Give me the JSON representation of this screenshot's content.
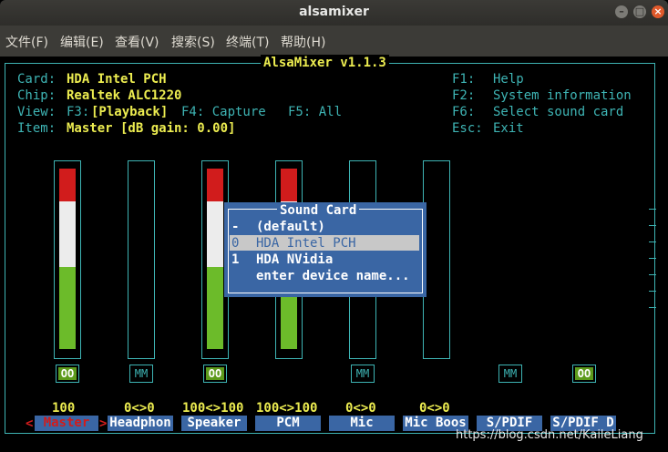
{
  "window": {
    "title": "alsamixer"
  },
  "menu": [
    "文件(F)",
    "编辑(E)",
    "查看(V)",
    "搜索(S)",
    "终端(T)",
    "帮助(H)"
  ],
  "app": {
    "title": "AlsaMixer v1.1.3"
  },
  "info": {
    "card_label": "Card:",
    "card_value": "HDA Intel PCH",
    "chip_label": "Chip:",
    "chip_value": "Realtek ALC1220",
    "view_label": "View:",
    "view_f3": "F3:",
    "view_playback": "[Playback]",
    "view_f4": "F4: Capture",
    "view_f5": "F5: All",
    "item_label": "Item:",
    "item_value": "Master [dB gain: 0.00]"
  },
  "help": [
    {
      "key": "F1:",
      "text": "Help"
    },
    {
      "key": "F2:",
      "text": "System information"
    },
    {
      "key": "F6:",
      "text": "Select sound card"
    },
    {
      "key": "Esc:",
      "text": "Exit"
    }
  ],
  "controls": [
    {
      "label": "Master",
      "value": "100",
      "mute": "OO",
      "active": true,
      "level": 1.0
    },
    {
      "label": "Headphon",
      "value": "0<>0",
      "mute": "MM",
      "active": false,
      "level": 0.0
    },
    {
      "label": "Speaker",
      "value": "100<>100",
      "mute": "OO",
      "active": false,
      "level": 1.0
    },
    {
      "label": "PCM",
      "value": "100<>100",
      "mute": "",
      "active": false,
      "level": 1.0
    },
    {
      "label": "Mic",
      "value": "0<>0",
      "mute": "MM",
      "active": false,
      "level": 0.0
    },
    {
      "label": "Mic Boos",
      "value": "0<>0",
      "mute": "",
      "active": false,
      "level": 0.0
    },
    {
      "label": "S/PDIF",
      "value": "",
      "mute": "MM",
      "active": false
    },
    {
      "label": "S/PDIF D",
      "value": "",
      "mute": "OO",
      "active": false
    }
  ],
  "dialog": {
    "title": "Sound Card",
    "items": [
      {
        "key": "-",
        "name": "(default)"
      },
      {
        "key": "0",
        "name": "HDA Intel PCH",
        "selected": true
      },
      {
        "key": "1",
        "name": "HDA NVidia"
      },
      {
        "key": "",
        "name": "enter device name..."
      }
    ]
  },
  "watermark": "https://blog.csdn.net/KaileLiang",
  "colors": {
    "accent": "#3eb4b4",
    "label_bg": "#3a66a4",
    "yellow": "#ecec50",
    "green": "#5c9a1b",
    "red": "#d11c1c"
  }
}
